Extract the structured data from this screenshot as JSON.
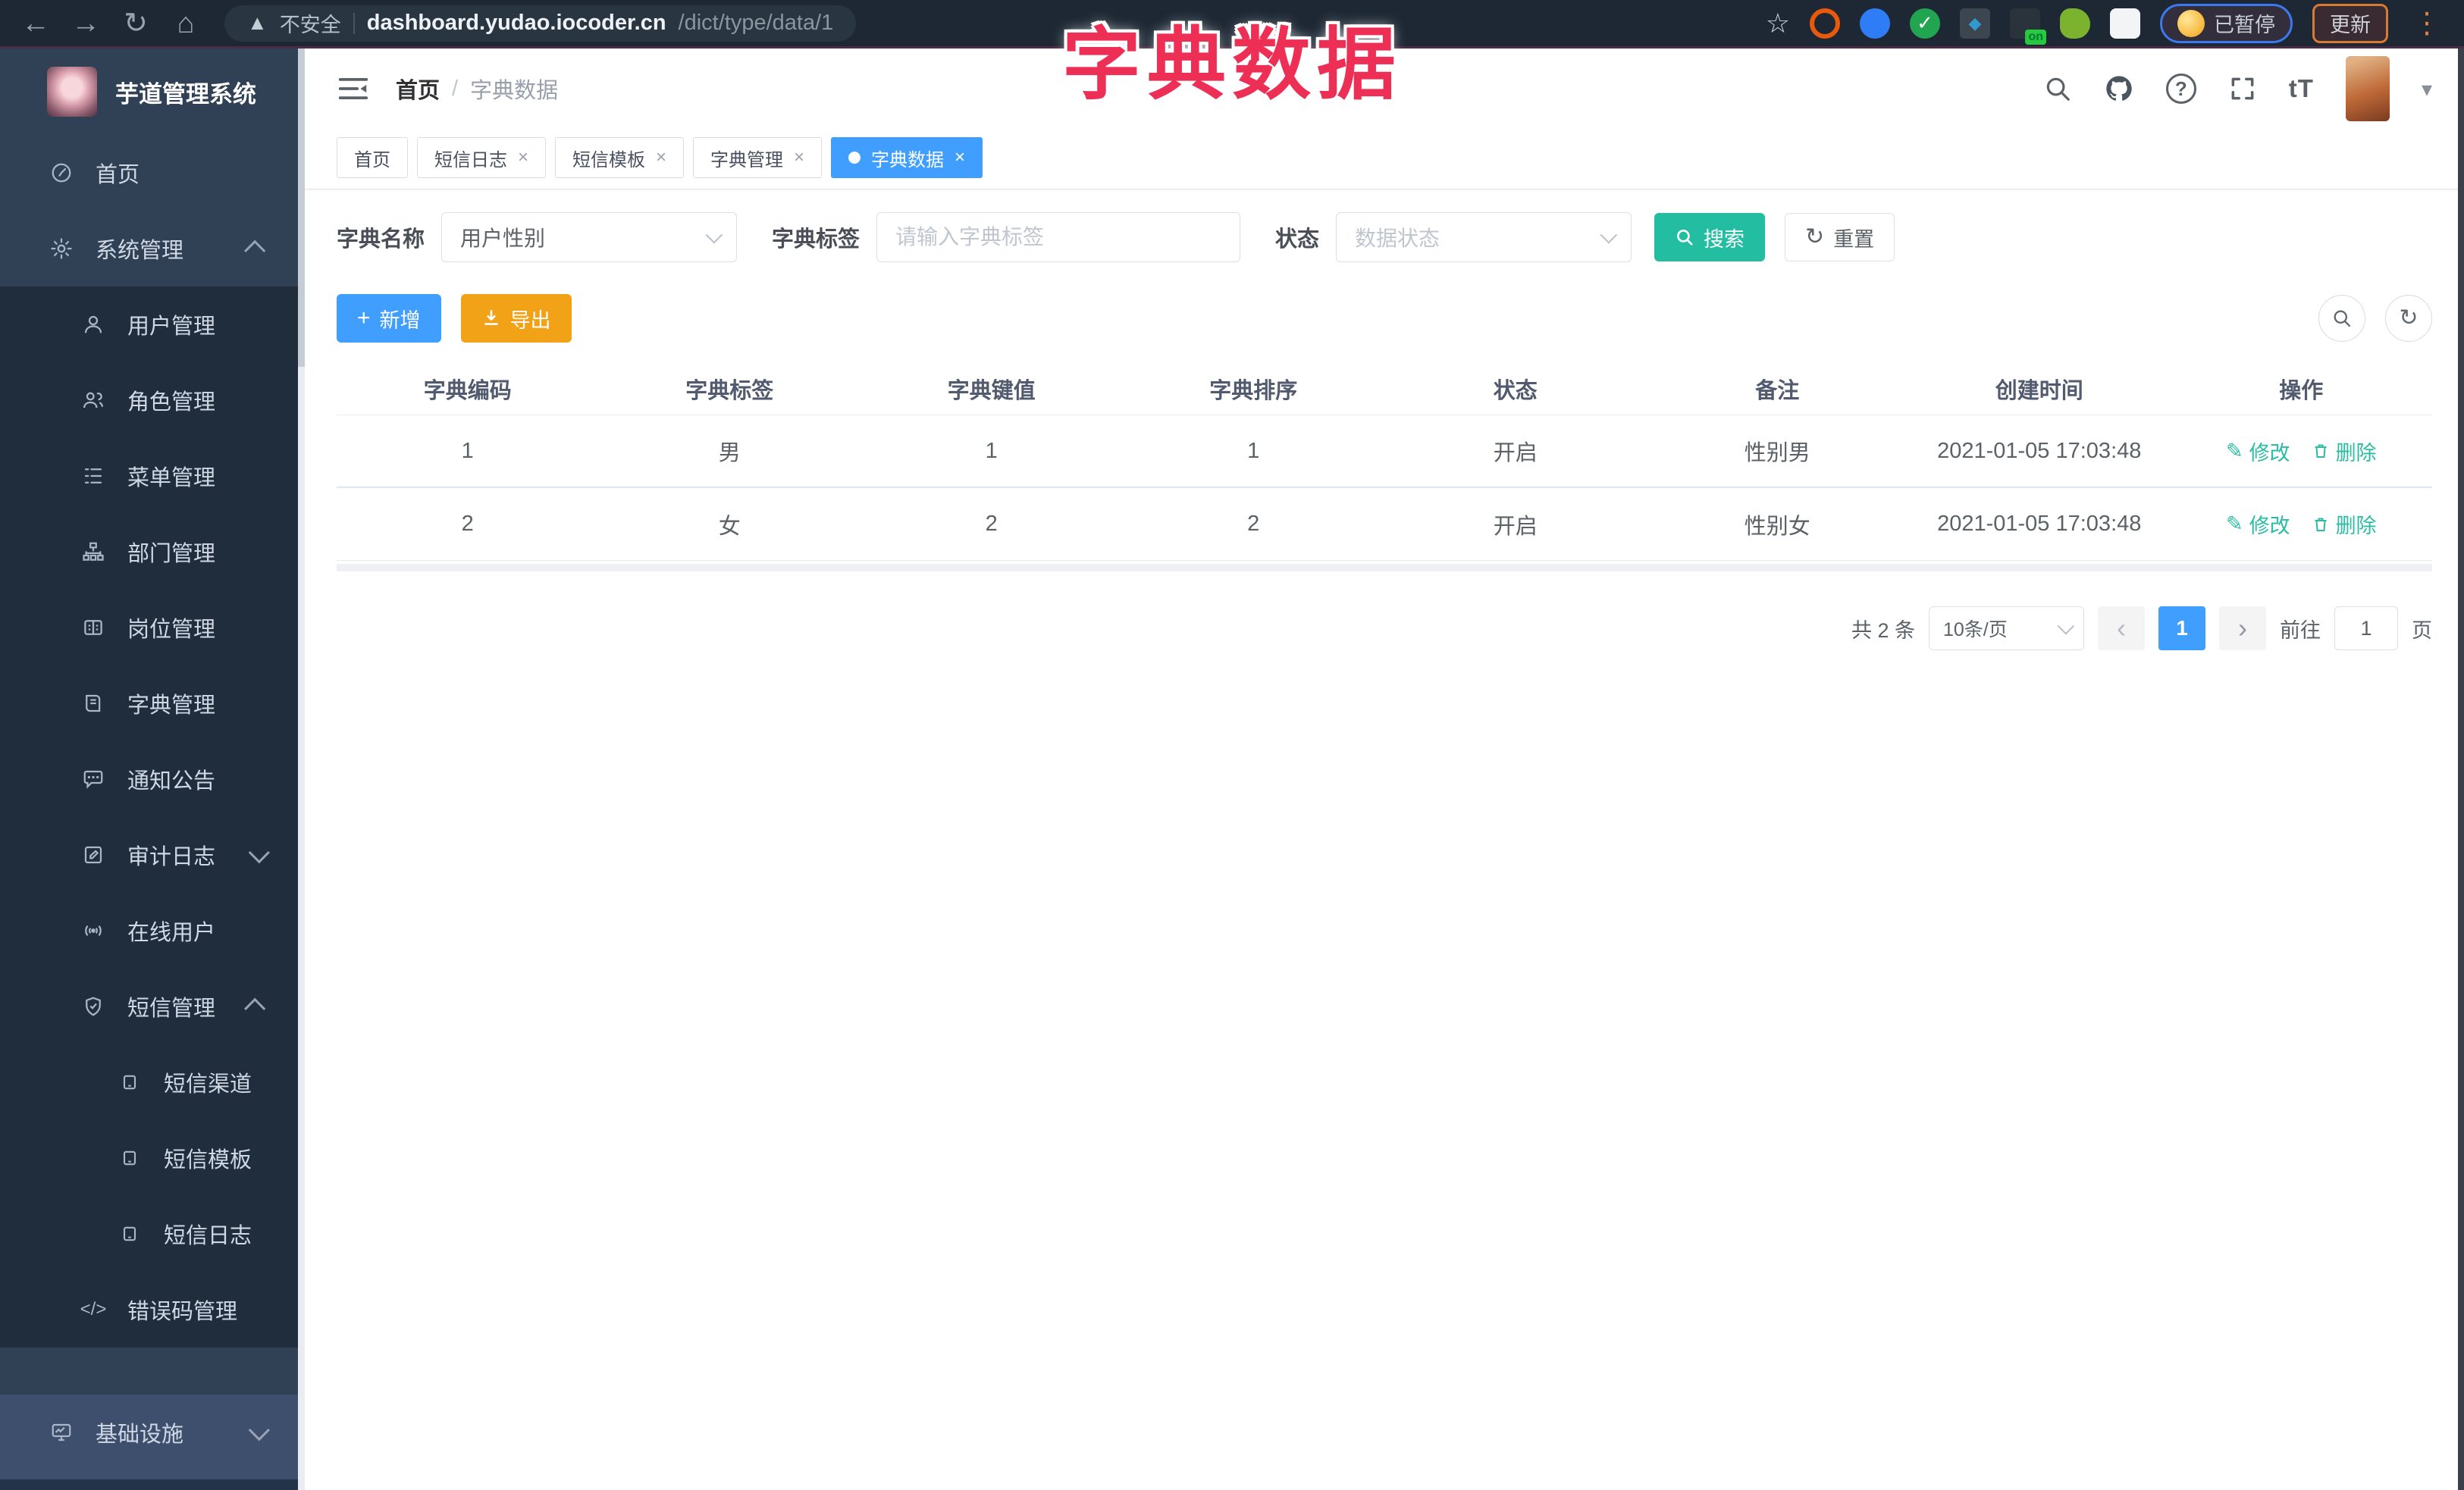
{
  "browser": {
    "security_label": "不安全",
    "url_host": "dashboard.yudao.iocoder.cn",
    "url_path": "/dict/type/data/1",
    "paused_chip": "已暂停",
    "update_button": "更新",
    "extension_on_badge": "on"
  },
  "overlay": {
    "title": "字典数据"
  },
  "sidebar": {
    "app_title": "芋道管理系统",
    "items": [
      {
        "label": "首页"
      },
      {
        "label": "系统管理"
      },
      {
        "label": "用户管理"
      },
      {
        "label": "角色管理"
      },
      {
        "label": "菜单管理"
      },
      {
        "label": "部门管理"
      },
      {
        "label": "岗位管理"
      },
      {
        "label": "字典管理"
      },
      {
        "label": "通知公告"
      },
      {
        "label": "审计日志"
      },
      {
        "label": "在线用户"
      },
      {
        "label": "短信管理"
      },
      {
        "label": "短信渠道"
      },
      {
        "label": "短信模板"
      },
      {
        "label": "短信日志"
      },
      {
        "label": "错误码管理"
      },
      {
        "label": "基础设施"
      }
    ]
  },
  "header": {
    "breadcrumb_home": "首页",
    "breadcrumb_sep": "/",
    "breadcrumb_current": "字典数据"
  },
  "tabs": [
    {
      "label": "首页"
    },
    {
      "label": "短信日志"
    },
    {
      "label": "短信模板"
    },
    {
      "label": "字典管理"
    },
    {
      "label": "字典数据"
    }
  ],
  "filters": {
    "dict_name_label": "字典名称",
    "dict_name_value": "用户性别",
    "dict_label_label": "字典标签",
    "dict_label_placeholder": "请输入字典标签",
    "status_label": "状态",
    "status_placeholder": "数据状态",
    "search_button": "搜索",
    "reset_button": "重置"
  },
  "toolbar": {
    "add_button": "新增",
    "export_button": "导出"
  },
  "table": {
    "headers": [
      "字典编码",
      "字典标签",
      "字典键值",
      "字典排序",
      "状态",
      "备注",
      "创建时间",
      "操作"
    ],
    "rows": [
      {
        "code": "1",
        "label": "男",
        "value": "1",
        "sort": "1",
        "status": "开启",
        "remark": "性别男",
        "created": "2021-01-05 17:03:48",
        "edit": "修改",
        "delete": "删除"
      },
      {
        "code": "2",
        "label": "女",
        "value": "2",
        "sort": "2",
        "status": "开启",
        "remark": "性别女",
        "created": "2021-01-05 17:03:48",
        "edit": "修改",
        "delete": "删除"
      }
    ]
  },
  "pagination": {
    "total": "共 2 条",
    "page_size": "10条/页",
    "current_page": "1",
    "goto_label": "前往",
    "goto_value": "1",
    "page_suffix": "页"
  },
  "icons": {
    "back": "←",
    "forward": "→",
    "reload": "↻",
    "home": "⌂",
    "star": "☆",
    "kebab": "⋮",
    "caret_down": "▾",
    "edit_pencil": "✎",
    "plus": "+",
    "close": "×",
    "code_glyph": "</>",
    "text_size": "tT",
    "question": "?",
    "prev": "‹",
    "next": "›",
    "warning": "▲"
  },
  "colors": {
    "accent_blue": "#409eff",
    "teal": "#23bda2",
    "export_orange": "#f2a216",
    "sidebar_bg": "#304156",
    "submenu_bg": "#1f2d3d",
    "annotation_red": "#ee2f55"
  }
}
